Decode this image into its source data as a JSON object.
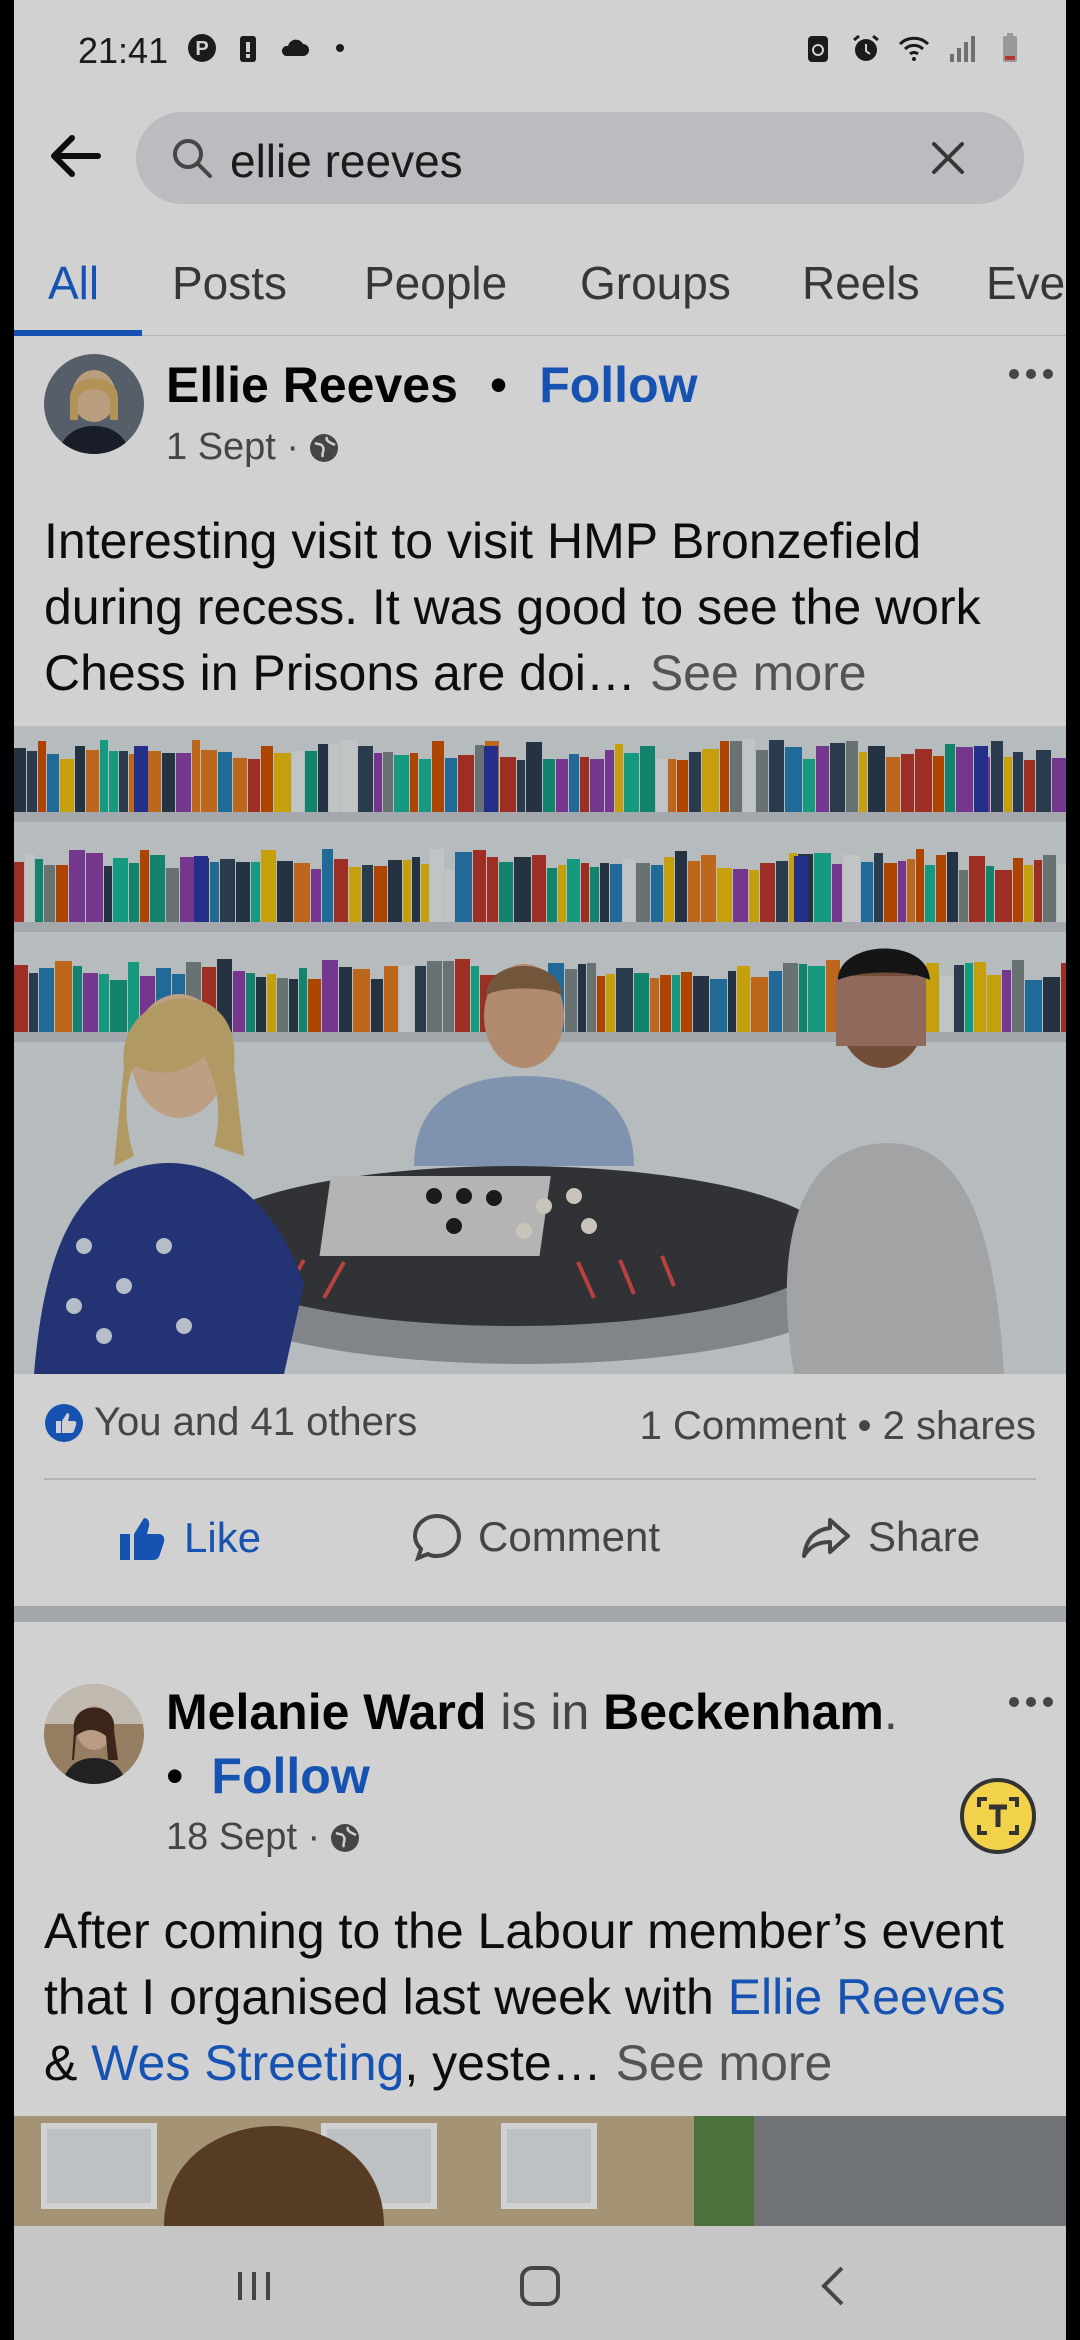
{
  "status_bar": {
    "time": "21:41",
    "left_icons": [
      "pinterest-icon",
      "battery-saver-icon",
      "cloud-icon",
      "dot-icon"
    ],
    "right_icons": [
      "recycle-icon",
      "alarm-icon",
      "wifi-icon",
      "signal-icon",
      "battery-icon"
    ]
  },
  "search": {
    "query": "ellie reeves"
  },
  "tabs": [
    {
      "label": "All",
      "active": true
    },
    {
      "label": "Posts"
    },
    {
      "label": "People"
    },
    {
      "label": "Groups"
    },
    {
      "label": "Reels"
    },
    {
      "label": "Eve"
    }
  ],
  "post1": {
    "author": "Ellie Reeves",
    "separator": "•",
    "follow": "Follow",
    "date": "1 Sept ·",
    "text": "Interesting visit to visit HMP Bronzefield during recess. It was good to see the work  Chess in Prisons are doi…",
    "see_more": "See more",
    "reactions_text": "You and 41 others",
    "stats": "1 Comment • 2 shares",
    "actions": {
      "like": "Like",
      "comment": "Comment",
      "share": "Share"
    }
  },
  "post2": {
    "author": "Melanie Ward",
    "is_in": "is in",
    "location": "Beckenham",
    "period": ".",
    "bullet": "•",
    "follow": "Follow",
    "date": "18 Sept ·",
    "text_a": "After coming to the Labour member’s event that I organised last week with ",
    "link1": "Ellie Reeves",
    "amp": " & ",
    "link2": "Wes Streeting",
    "text_b": ", yeste…",
    "see_more": "See more"
  },
  "colors": {
    "accent": "#1b65d8",
    "lens": "#f2d24b"
  }
}
